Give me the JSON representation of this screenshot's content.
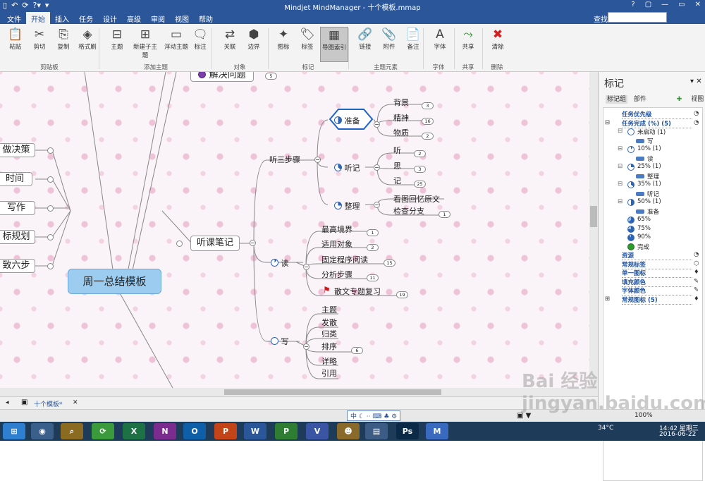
{
  "titlebar": {
    "title": "Mindjet MindManager - 十个模板.mmap",
    "qa": [
      "▯",
      "↶",
      "⟳",
      "?▾",
      "▾"
    ],
    "win": [
      "?",
      "▢",
      "—",
      "▭",
      "✕"
    ]
  },
  "tabs": [
    "文件",
    "开始",
    "插入",
    "任务",
    "设计",
    "高级",
    "审阅",
    "视图",
    "帮助"
  ],
  "active_tab": "开始",
  "search": {
    "label": "查找:",
    "placeholder": ""
  },
  "ribbon": {
    "buttons": [
      {
        "label": "粘贴",
        "icon": "paste-icon",
        "glyph": "📋"
      },
      {
        "label": "剪切",
        "icon": "scissors-icon",
        "glyph": "✂"
      },
      {
        "label": "复制",
        "icon": "copy-icon",
        "glyph": "⎘"
      },
      {
        "label": "格式刷",
        "icon": "format-painter-icon",
        "glyph": "◈"
      },
      {
        "label": "主题",
        "icon": "topic-icon",
        "glyph": "⊟"
      },
      {
        "label": "新建子主题",
        "icon": "subtopic-icon",
        "glyph": "⊞"
      },
      {
        "label": "浮动主题",
        "icon": "floating-topic-icon",
        "glyph": "▭"
      },
      {
        "label": "标注",
        "icon": "callout-icon",
        "glyph": "🗨"
      },
      {
        "label": "关联",
        "icon": "relationship-icon",
        "glyph": "⇄"
      },
      {
        "label": "边界",
        "icon": "boundary-icon",
        "glyph": "⬢"
      },
      {
        "label": "图标",
        "icon": "icons-icon",
        "glyph": "✦"
      },
      {
        "label": "标签",
        "icon": "tag-icon",
        "glyph": "🏷"
      },
      {
        "label": "导图索引",
        "icon": "map-index-icon",
        "glyph": "▦"
      },
      {
        "label": "链接",
        "icon": "link-icon",
        "glyph": "🔗"
      },
      {
        "label": "附件",
        "icon": "attachment-icon",
        "glyph": "📎"
      },
      {
        "label": "备注",
        "icon": "notes-icon",
        "glyph": "📄"
      },
      {
        "label": "字体",
        "icon": "font-icon",
        "glyph": "A"
      },
      {
        "label": "共享",
        "icon": "share-icon",
        "glyph": "⤳"
      },
      {
        "label": "清除",
        "icon": "clear-icon",
        "glyph": "✖"
      }
    ],
    "groups": [
      "剪贴板",
      "添加主题",
      "对象",
      "标记",
      "主题元素",
      "字体",
      "共享",
      "删除"
    ]
  },
  "map": {
    "central": "周一总结模板",
    "top_partial": "解决问题",
    "top_partial_count": "5",
    "left": [
      "做决策",
      "时间",
      "写作",
      "标规划",
      "致六步"
    ],
    "main_branch": "听课笔记",
    "sub_steps": "听三步骤",
    "prepare": "准备",
    "prepare_children": [
      {
        "t": "背景",
        "n": "3"
      },
      {
        "t": "精神",
        "n": "16"
      },
      {
        "t": "物质",
        "n": "2"
      }
    ],
    "listen": "听记",
    "listen_children": [
      {
        "t": "听",
        "n": "2"
      },
      {
        "t": "思",
        "n": "3"
      },
      {
        "t": "记",
        "n": "25"
      }
    ],
    "organize": "整理",
    "organize_children": [
      {
        "t": "看图回忆原文",
        "n": ""
      },
      {
        "t": "检查分支",
        "n": "1"
      }
    ],
    "read": "读",
    "read_children": [
      {
        "t": "最高境界",
        "n": "1"
      },
      {
        "t": "适用对象",
        "n": "2"
      },
      {
        "t": "固定程序阅读",
        "n": "15"
      },
      {
        "t": "分析步骤",
        "n": "11"
      },
      {
        "t": "散文专题复习",
        "n": "19"
      }
    ],
    "write": "写",
    "write_children": [
      "主题",
      "发散",
      "归类",
      "排序",
      "详略",
      "引用"
    ],
    "write_badge": "6"
  },
  "doc_tab": "十个模板*",
  "panel": {
    "title": "标记",
    "tabs": [
      "标记组",
      "部件",
      "视图"
    ],
    "rows": [
      {
        "t": "任务优先级",
        "kind": "group"
      },
      {
        "t": "任务完成 (%) (5)",
        "kind": "group"
      },
      {
        "t": "未启动 (1)",
        "kind": "item",
        "pi": "p0"
      },
      {
        "t": "写",
        "kind": "topic"
      },
      {
        "t": "10% (1)",
        "kind": "item",
        "pi": "p10"
      },
      {
        "t": "读",
        "kind": "topic"
      },
      {
        "t": "25% (1)",
        "kind": "item",
        "pi": "p25"
      },
      {
        "t": "整理",
        "kind": "topic"
      },
      {
        "t": "35% (1)",
        "kind": "item",
        "pi": "p35"
      },
      {
        "t": "听记",
        "kind": "topic"
      },
      {
        "t": "50% (1)",
        "kind": "item",
        "pi": "p50"
      },
      {
        "t": "准备",
        "kind": "topic"
      },
      {
        "t": "65%",
        "kind": "item",
        "pi": "p65"
      },
      {
        "t": "75%",
        "kind": "item",
        "pi": "p75"
      },
      {
        "t": "90%",
        "kind": "item",
        "pi": "p90"
      },
      {
        "t": "完成",
        "kind": "item",
        "pi": "pdone"
      },
      {
        "t": "资源",
        "kind": "group"
      },
      {
        "t": "常规标签",
        "kind": "group"
      },
      {
        "t": "单一图标",
        "kind": "group"
      },
      {
        "t": "填充颜色",
        "kind": "group"
      },
      {
        "t": "字体颜色",
        "kind": "group"
      },
      {
        "t": "常规图标 (5)",
        "kind": "group"
      }
    ]
  },
  "status": {
    "zoom_icons": "中 ☾ ·· ⌨ ♣ ⚙",
    "percent": "100%"
  },
  "watermark": "Bai 经验 jingyan.baidu.com",
  "taskbar": {
    "apps": [
      {
        "label": "⊞",
        "color": "#2f7fd1"
      },
      {
        "label": "◉",
        "color": "#3a5f8a"
      },
      {
        "label": "⌕",
        "color": "#8b6a22"
      },
      {
        "label": "⟳",
        "color": "#3b9a3b"
      },
      {
        "label": "X",
        "color": "#1e7145"
      },
      {
        "label": "N",
        "color": "#7b2c8e"
      },
      {
        "label": "O",
        "color": "#0f5ea8"
      },
      {
        "label": "P",
        "color": "#c4441a"
      },
      {
        "label": "W",
        "color": "#2b579a"
      },
      {
        "label": "P",
        "color": "#2e7d32"
      },
      {
        "label": "V",
        "color": "#3955a3"
      },
      {
        "label": "☻",
        "color": "#8a6a2a"
      },
      {
        "label": "▤",
        "color": "#3d5c85"
      },
      {
        "label": "Ps",
        "color": "#0a2a48"
      },
      {
        "label": "M",
        "color": "#3a6ac0"
      }
    ],
    "temp": "34°C",
    "time": "14:42 星期三",
    "date": "2016-06-22"
  },
  "colors": {
    "accent": "#2b579a",
    "central_fill": "#9ccdf0",
    "canvas": "#faf3f7"
  }
}
